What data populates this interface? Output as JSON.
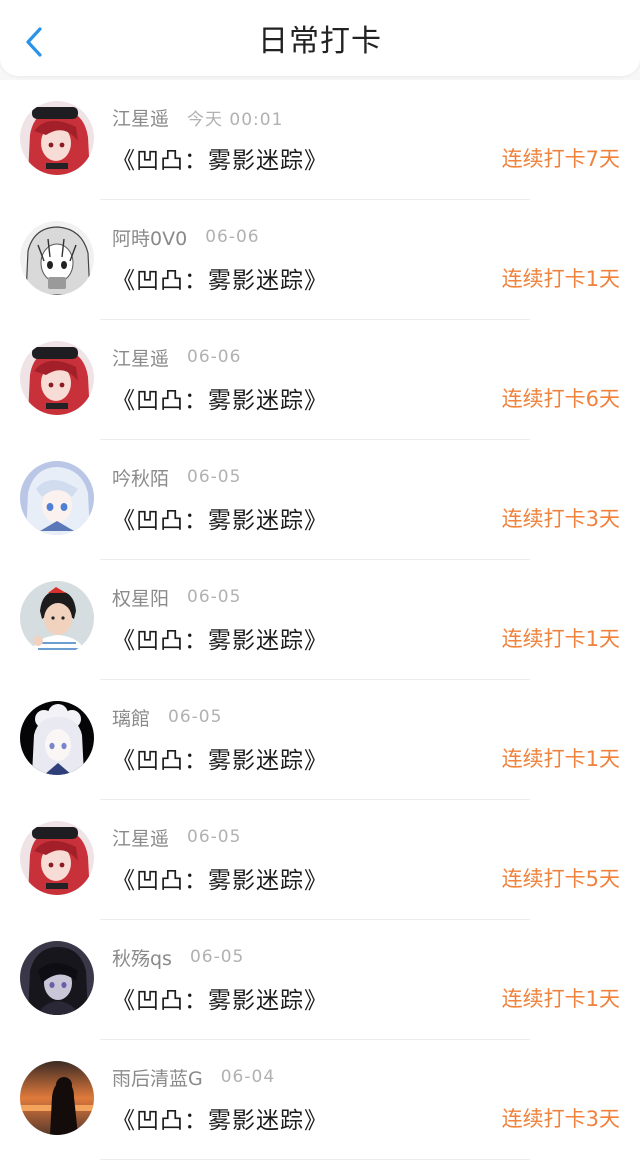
{
  "header": {
    "title": "日常打卡",
    "back_icon": "chevron-left-icon",
    "accent_color": "#2a93e8"
  },
  "colors": {
    "streak": "#f0823c",
    "name": "#8a8a8a",
    "time": "#b1b1b1"
  },
  "entries": [
    {
      "name": "江星遥",
      "time": "今天 00:01",
      "game": "《凹凸：雾影迷踪》",
      "streak": "连续打卡7天",
      "avatar": "avatar-red-hair"
    },
    {
      "name": "阿時0V0",
      "time": "06-06",
      "game": "《凹凸：雾影迷踪》",
      "streak": "连续打卡1天",
      "avatar": "avatar-manga-girl"
    },
    {
      "name": "江星遥",
      "time": "06-06",
      "game": "《凹凸：雾影迷踪》",
      "streak": "连续打卡6天",
      "avatar": "avatar-red-hair"
    },
    {
      "name": "吟秋陌",
      "time": "06-05",
      "game": "《凹凸：雾影迷踪》",
      "streak": "连续打卡3天",
      "avatar": "avatar-silver-hair"
    },
    {
      "name": "权星阳",
      "time": "06-05",
      "game": "《凹凸：雾影迷踪》",
      "streak": "连续打卡1天",
      "avatar": "avatar-boy-photo"
    },
    {
      "name": "璃館",
      "time": "06-05",
      "game": "《凹凸：雾影迷踪》",
      "streak": "连续打卡1天",
      "avatar": "avatar-white-girl-dark"
    },
    {
      "name": "江星遥",
      "time": "06-05",
      "game": "《凹凸：雾影迷踪》",
      "streak": "连续打卡5天",
      "avatar": "avatar-red-hair"
    },
    {
      "name": "秋殇qs",
      "time": "06-05",
      "game": "《凹凸：雾影迷踪》",
      "streak": "连续打卡1天",
      "avatar": "avatar-dark-hair"
    },
    {
      "name": "雨后清蓝G",
      "time": "06-04",
      "game": "《凹凸：雾影迷踪》",
      "streak": "连续打卡3天",
      "avatar": "avatar-sunset-silhouette"
    }
  ]
}
